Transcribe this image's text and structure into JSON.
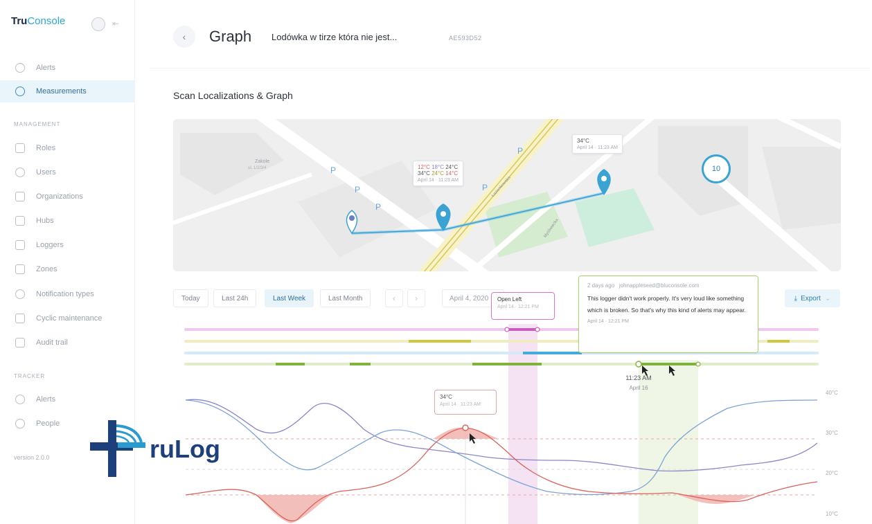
{
  "brand": {
    "tru": "Tru",
    "console": "Console"
  },
  "sidebar": {
    "items": [
      {
        "label": "Alerts",
        "icon": "bell-icon"
      },
      {
        "label": "Measurements",
        "icon": "gauge-icon"
      }
    ],
    "management_heading": "MANAGEMENT",
    "management": [
      {
        "label": "Roles",
        "icon": "roles-icon"
      },
      {
        "label": "Users",
        "icon": "user-icon"
      },
      {
        "label": "Organizations",
        "icon": "building-icon"
      },
      {
        "label": "Hubs",
        "icon": "hub-icon"
      },
      {
        "label": "Loggers",
        "icon": "logger-icon"
      },
      {
        "label": "Zones",
        "icon": "zone-icon"
      },
      {
        "label": "Notification types",
        "icon": "notification-icon"
      },
      {
        "label": "Cyclic maintenance",
        "icon": "calendar-icon"
      },
      {
        "label": "Audit trail",
        "icon": "audit-icon"
      }
    ],
    "tracker_heading": "TRACKER",
    "tracker": [
      {
        "label": "Alerts",
        "icon": "bell-icon"
      },
      {
        "label": "People",
        "icon": "people-icon"
      }
    ],
    "version": "version 2.0.0"
  },
  "header": {
    "title": "Graph",
    "device_name": "Lodówka w tirze która nie jest...",
    "device_id": "AE593D52"
  },
  "section_title": "Scan Localizations & Graph",
  "map": {
    "tooltip_multi": {
      "row1": [
        "12°C",
        "18°C",
        "24°C"
      ],
      "row2": [
        "34°C",
        "24°C",
        "14°C"
      ],
      "time": "April 14 · 11:23 AM"
    },
    "tooltip_single": {
      "temp": "34°C",
      "time": "April 14 · 11:23 AM"
    },
    "cluster_count": "10",
    "zakole_label": "Zakole",
    "zakole_sub": "ul. 1/2/3/4",
    "street_1": "Łazienkowska",
    "street_2": "Myśliwiecka"
  },
  "toolbar": {
    "today": "Today",
    "last24h": "Last 24h",
    "last_week": "Last Week",
    "last_month": "Last Month",
    "date": "April 4, 2020",
    "export": "Export"
  },
  "events": {
    "open_left": {
      "title": "Open Left",
      "time": "April 14 · 12:21 PM"
    },
    "comment": {
      "ago": "2 days ago",
      "email": "johnappleseed@bluconsole.com",
      "body": "This logger didn't work properly. It's very loud like something which is broken. So that's why this kind of alerts may appear.",
      "time": "April 14 · 12:21 PM"
    },
    "marker_time": "11:23 AM",
    "marker_date": "April 16"
  },
  "chart": {
    "peak": {
      "temp": "34°C",
      "time": "April 14 · 11:23 AM"
    },
    "y_ticks": [
      "40°C",
      "30°C",
      "20°C",
      "10°C"
    ]
  },
  "watermark": {
    "text": "ruLog"
  },
  "colors": {
    "accent": "#2aa6d6",
    "pink": "#d776c8",
    "green": "#8bbf4a",
    "yellow": "#d6cf45",
    "red": "#d9625a",
    "purple": "#8a86c9",
    "blue": "#7aa2d8"
  }
}
